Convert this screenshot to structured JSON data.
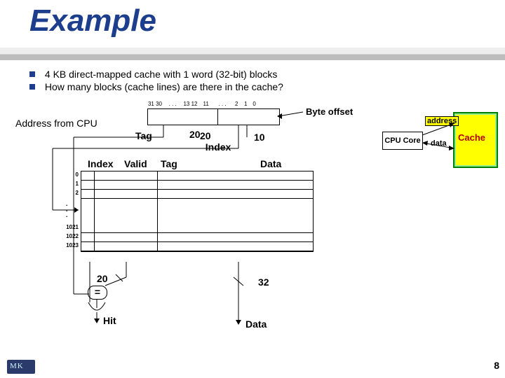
{
  "title": "Example",
  "bullets": [
    "4 KB direct-mapped cache with 1 word (32-bit) blocks",
    "How many blocks (cache lines) are there in the cache?"
  ],
  "address": {
    "bit_groups": [
      "31 30",
      ". . .",
      "13 12",
      "11",
      ". . .",
      "2",
      "1",
      "0"
    ],
    "from_label": "Address from CPU",
    "tag_label": "Tag",
    "index_label": "20\n  Index",
    "tag_width": "20",
    "index_width": "10",
    "byte_offset_label": "Byte offset"
  },
  "table": {
    "headers": {
      "index": "Index",
      "valid": "Valid",
      "tag": "Tag",
      "data": "Data"
    },
    "top_rows": [
      "0",
      "1",
      "2"
    ],
    "bottom_rows": [
      "1021",
      "1022",
      "1023"
    ]
  },
  "compare": {
    "tag_bus": "20",
    "data_bus": "32",
    "eq": "=",
    "hit": "Hit",
    "data_out": "Data"
  },
  "right": {
    "cpu_core": "CPU Core",
    "cache": "Cache",
    "address_pin": "address",
    "data_pin": "data"
  },
  "page_number": "8",
  "chart_data": {
    "type": "diagram",
    "topic": "Direct-mapped cache address decomposition",
    "address_bits": 32,
    "fields": [
      {
        "name": "Tag",
        "bits": 20,
        "range": "31:12"
      },
      {
        "name": "Index",
        "bits": 10,
        "range": "11:2"
      },
      {
        "name": "Byte offset",
        "bits": 2,
        "range": "1:0"
      }
    ],
    "cache": {
      "size_bytes": 4096,
      "block_size_bytes": 4,
      "num_blocks": 1024,
      "columns": [
        "Index",
        "Valid",
        "Tag",
        "Data"
      ],
      "index_range": [
        0,
        1023
      ]
    },
    "outputs": {
      "hit": "Hit",
      "data_width_bits": 32
    }
  }
}
